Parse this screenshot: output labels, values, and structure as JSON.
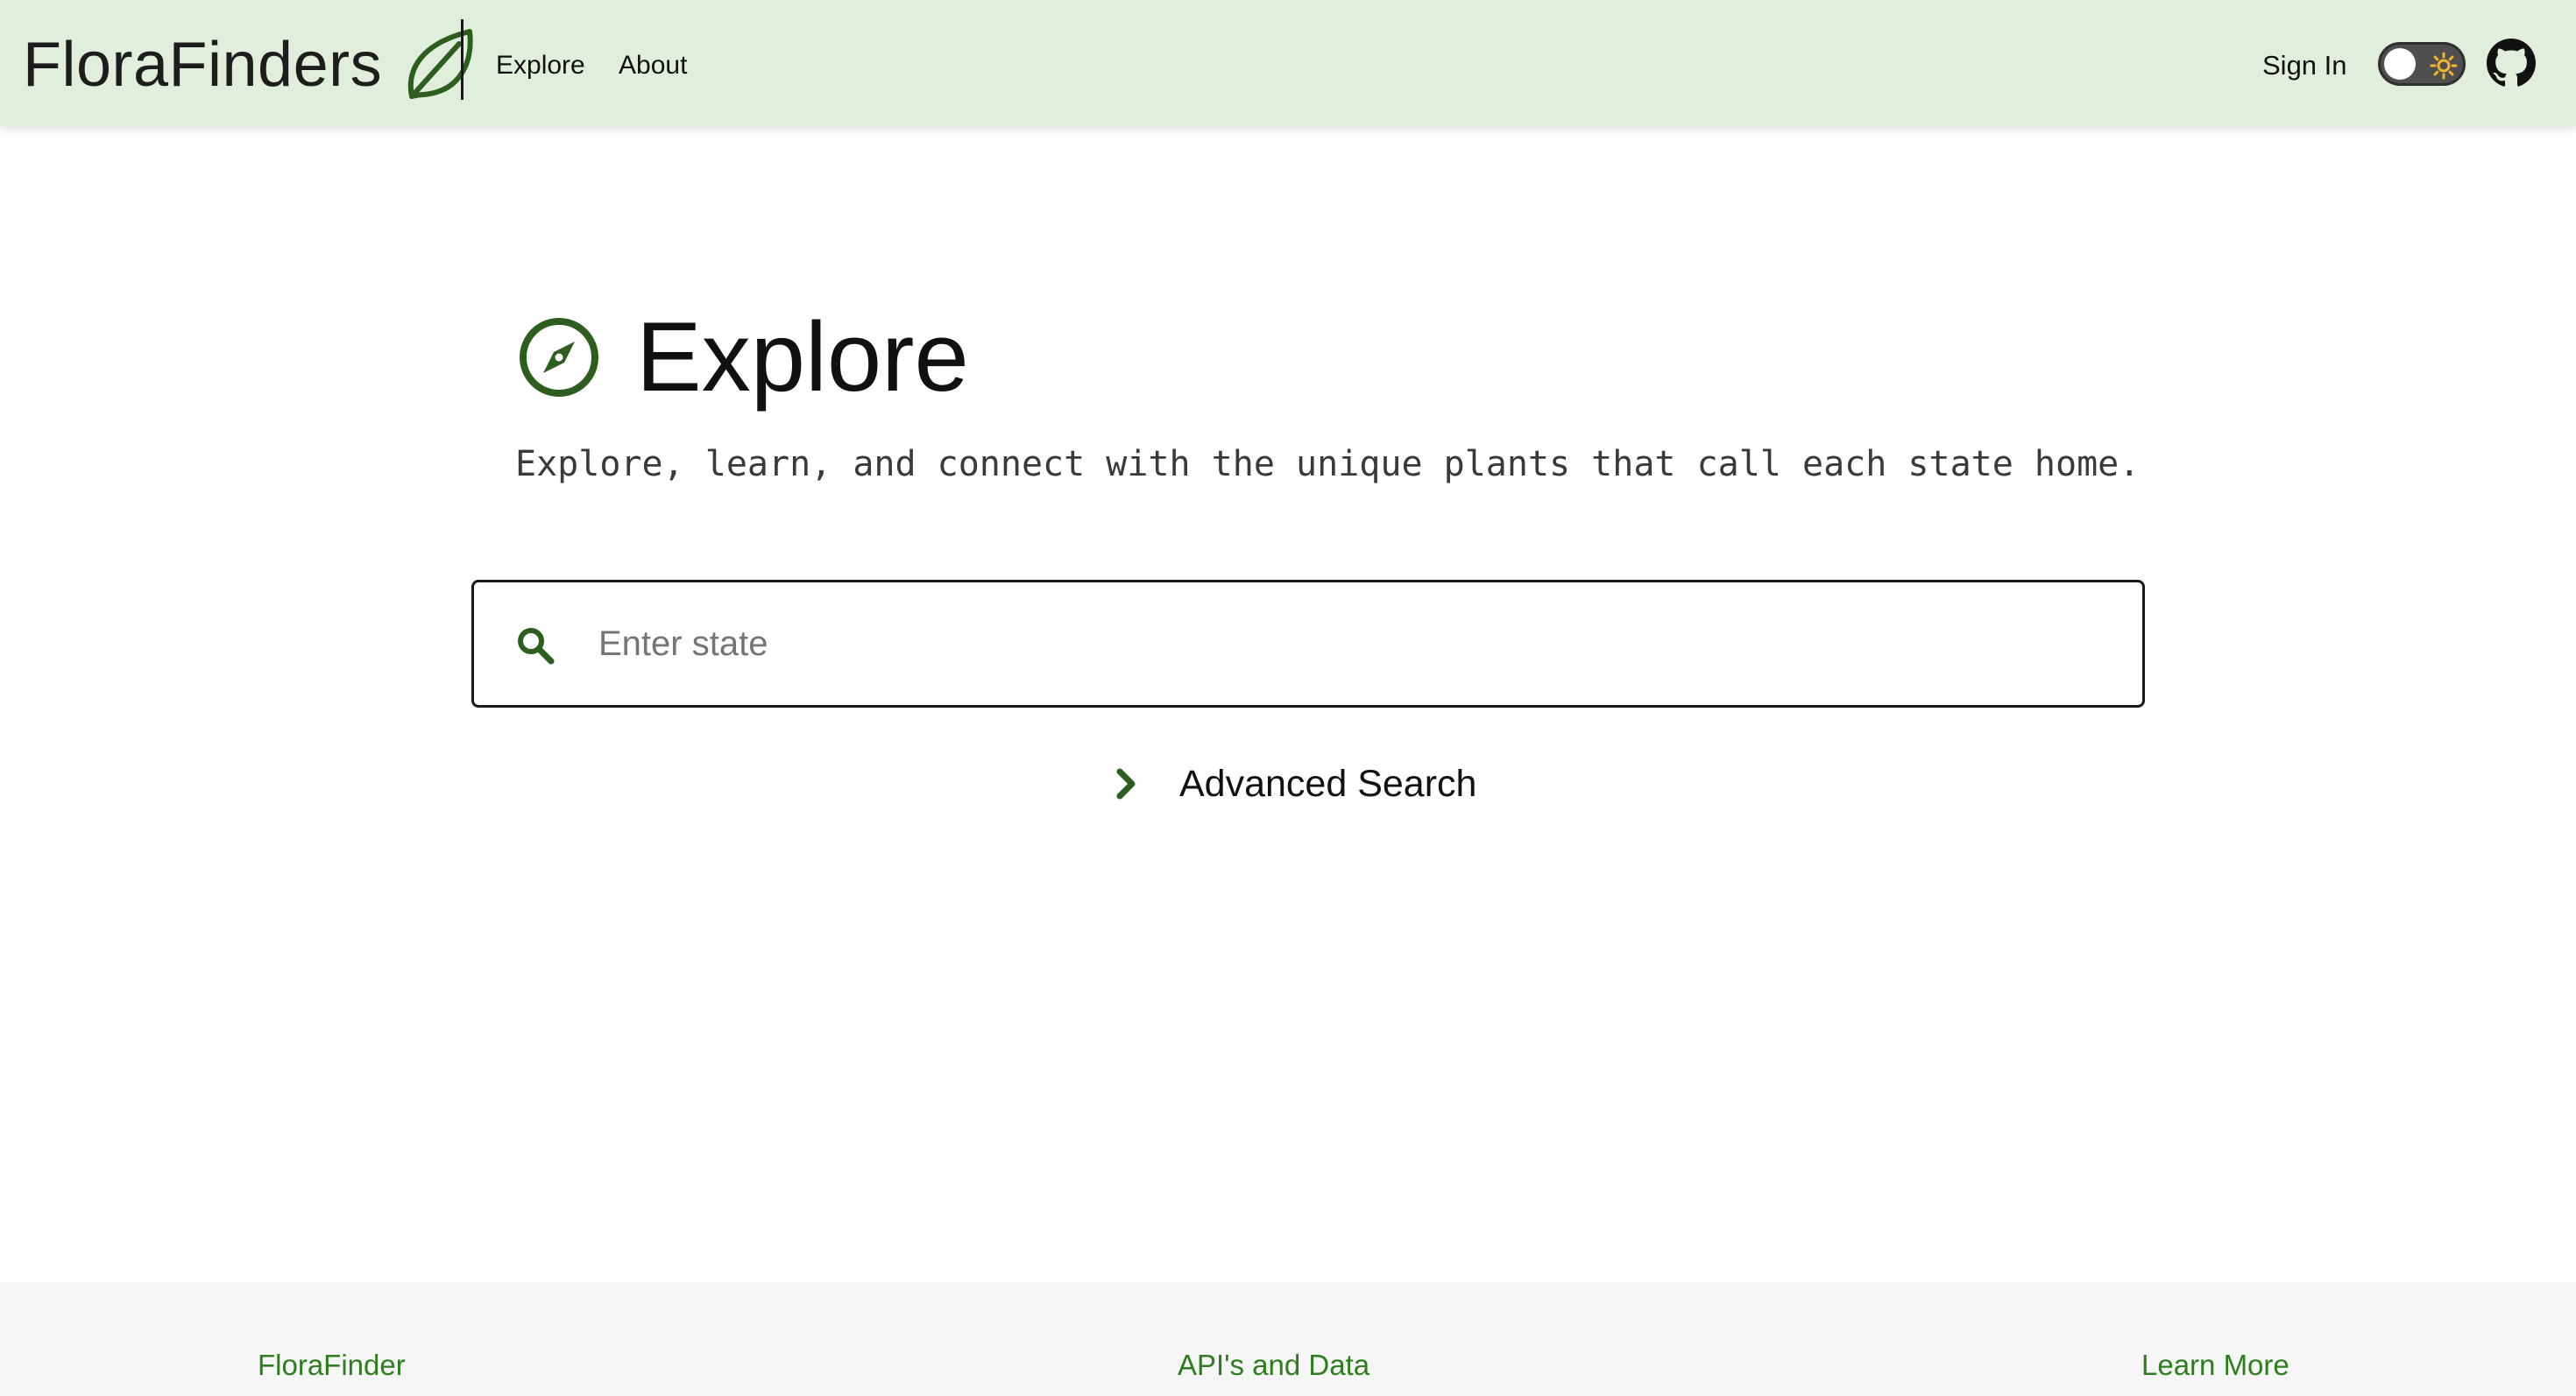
{
  "header": {
    "brand": "FloraFinders",
    "brand_icon": "leaf-icon",
    "nav": [
      {
        "label": "Explore"
      },
      {
        "label": "About"
      }
    ],
    "sign_in_label": "Sign In",
    "theme_toggle": {
      "state": "light",
      "icon": "sun-icon"
    },
    "github_icon": "github-icon",
    "background_color": "#e2eedc"
  },
  "main": {
    "title_icon": "compass-icon",
    "title": "Explore",
    "subtitle": "Explore, learn, and connect with the unique plants that call each state home.",
    "search": {
      "placeholder": "Enter state",
      "value": "",
      "icon": "search-icon"
    },
    "advanced_search": {
      "label": "Advanced Search",
      "icon": "chevron-right-icon"
    },
    "accent_color": "#2e5e1f"
  },
  "footer": {
    "columns": [
      {
        "label": "FloraFinder"
      },
      {
        "label": "API's and Data"
      },
      {
        "label": "Learn More"
      }
    ],
    "link_color": "#2e7d1e"
  }
}
